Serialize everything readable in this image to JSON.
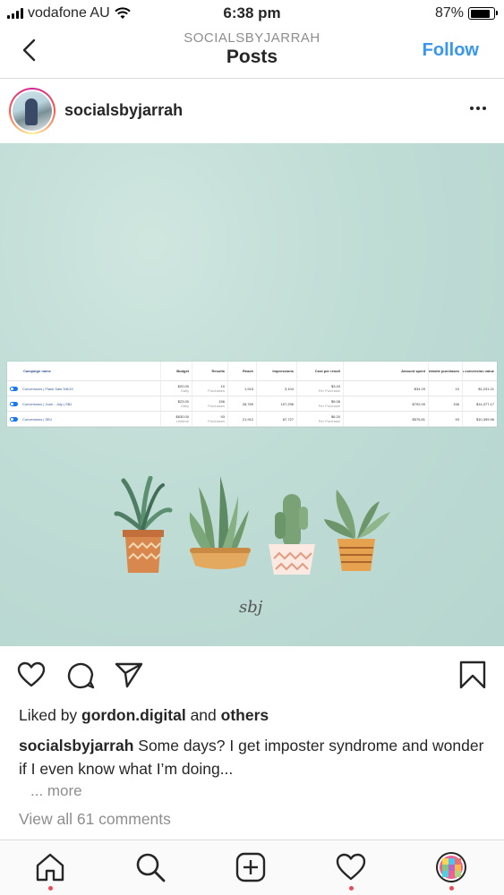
{
  "status_bar": {
    "carrier": "vodafone AU",
    "time": "6:38 pm",
    "battery": "87%",
    "battery_level": 0.87
  },
  "nav": {
    "subtitle": "SOCIALSBYJARRAH",
    "title": "Posts",
    "follow_label": "Follow"
  },
  "post": {
    "username": "socialsbyjarrah",
    "image": {
      "table": {
        "headers": [
          "Campaign name",
          "Budget",
          "Results",
          "Reach",
          "Impressions",
          "Cost per result",
          "Amount spent",
          "Website purchases",
          "Website purchases conversion value"
        ],
        "rows": [
          {
            "name": "Conversions | Flash Sale 5/6/19",
            "budget": "$20.00",
            "budget_sub": "Daily",
            "results": "10",
            "results_sub": "Purchases",
            "reach": "1,915",
            "impressions": "3,104",
            "cost": "$3.43",
            "cost_sub": "Per Purchase",
            "spent": "$34.29",
            "web": "10",
            "value": "$1,231.21"
          },
          {
            "name": "Conversions | June - July | SBJ",
            "budget": "$23.00",
            "budget_sub": "Daily",
            "results": "156",
            "results_sub": "Purchases",
            "reach": "28,769",
            "impressions": "107,296",
            "cost": "$5.08",
            "cost_sub": "Per Purchase",
            "spent": "$792.00",
            "web": "156",
            "value": "$14,377.17"
          },
          {
            "name": "Conversions | SBJ",
            "budget": "$630.00",
            "budget_sub": "Lifetime",
            "results": "93",
            "results_sub": "Purchases",
            "reach": "21,912",
            "impressions": "87,727",
            "cost": "$6.20",
            "cost_sub": "Per Purchase",
            "spent": "$576.81",
            "web": "93",
            "value": "$10,399.96"
          }
        ]
      },
      "signature": "sbj"
    },
    "liked_by_prefix": "Liked by ",
    "liked_by_user": "gordon.digital",
    "liked_by_and": " and ",
    "liked_by_others": "others",
    "caption_user": "socialsbyjarrah",
    "caption_text": " Some days? I get imposter syndrome and wonder if I even know what I’m doing...",
    "more_label": "... more",
    "view_comments": "View all 61 comments"
  },
  "colors": {
    "accent": "#3897f0",
    "notification_dot": "#ed4956",
    "image_background": "#bfdcd5"
  },
  "tabs": [
    "home-icon",
    "search-icon",
    "new-post-icon",
    "activity-heart-icon",
    "profile-icon"
  ]
}
